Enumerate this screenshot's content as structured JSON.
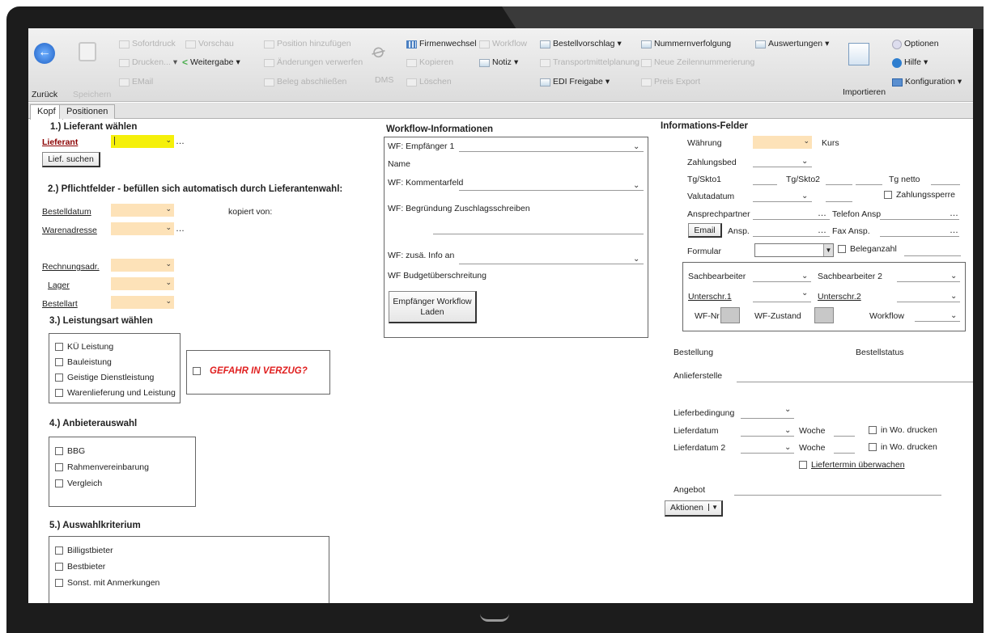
{
  "ribbon": {
    "back": "Zurück",
    "save": "Speichern",
    "sofortdruck": "Sofortdruck",
    "vorschau": "Vorschau",
    "drucken": "Drucken...",
    "weitergabe": "Weitergabe",
    "email": "EMail",
    "position_hinzufuegen": "Position hinzufügen",
    "aenderungen_verwerfen": "Änderungen verwerfen",
    "beleg_abschliessen": "Beleg abschließen",
    "dms": "DMS",
    "firmenwechsel": "Firmenwechsel",
    "workflow": "Workflow",
    "kopieren": "Kopieren",
    "notiz": "Notiz",
    "loeschen": "Löschen",
    "bestellvorschlag": "Bestellvorschlag",
    "transportmittelplanung": "Transportmittelplanung",
    "edi_freigabe": "EDI Freigabe",
    "nummernverfolgung": "Nummernverfolgung",
    "neue_zeilennummerierung": "Neue Zeilennummerierung",
    "preis_export": "Preis Export",
    "auswertungen": "Auswertungen",
    "importieren": "Importieren",
    "optionen": "Optionen",
    "hilfe": "Hilfe",
    "konfiguration": "Konfiguration"
  },
  "tabs": [
    "Kopf",
    "Positionen"
  ],
  "left": {
    "s1_title": "1.) Lieferant wählen",
    "lieferant": "Lieferant",
    "lief_suchen": "Lief. suchen",
    "s2_title": "2.) Pflichtfelder - befüllen sich automatisch durch Lieferantenwahl:",
    "bestelldatum": "Bestelldatum",
    "kopiert_von": "kopiert von:",
    "warenadresse": "Warenadresse",
    "rechnungsadr": "Rechnungsadr.",
    "lager": "Lager",
    "bestellart": "Bestellart",
    "s3_title": "3.) Leistungsart wählen",
    "s3_items": [
      "KÜ Leistung",
      "Bauleistung",
      "Geistige Dienstleistung",
      "Warenlieferung und Leistung"
    ],
    "gefahr": "GEFAHR IN VERZUG?",
    "s4_title": "4.) Anbieterauswahl",
    "s4_items": [
      "BBG",
      "Rahmenvereinbarung",
      "Vergleich"
    ],
    "s5_title": "5.) Auswahlkriterium",
    "s5_items": [
      "Billigstbieter",
      "Bestbieter",
      "Sonst. mit Anmerkungen"
    ]
  },
  "workflow": {
    "title": "Workflow-Informationen",
    "empfaenger": "WF: Empfänger 1",
    "name": "Name",
    "kommentar": "WF: Kommentarfeld",
    "begruendung": "WF: Begründung Zuschlagsschreiben",
    "zusae_info": "WF: zusä. Info an",
    "budget": "WF Budgetüberschreitung",
    "laden_btn": "Empfänger Workflow Laden"
  },
  "info": {
    "title": "Informations-Felder",
    "waehrung": "Währung",
    "kurs": "Kurs",
    "zahlungsbed": "Zahlungsbed",
    "tg_skto1": "Tg/Skto1",
    "tg_skto2": "Tg/Skto2",
    "tg_netto": "Tg netto",
    "valutadatum": "Valutadatum",
    "zahlungssperre": "Zahlungssperre",
    "ansprechpartner": "Ansprechpartner",
    "telefon": "Telefon Ansp",
    "email_btn": "Email",
    "ansp": "Ansp.",
    "fax": "Fax Ansp.",
    "formular": "Formular",
    "beleganzahl": "Beleganzahl",
    "sachbearbeiter": "Sachbearbeiter",
    "sachbearbeiter2": "Sachbearbeiter 2",
    "unterschr1": "Unterschr.1",
    "unterschr2": "Unterschr.2",
    "wf_nr": "WF-Nr",
    "wf_zustand": "WF-Zustand",
    "workflow": "Workflow",
    "bestellung": "Bestellung",
    "bestellstatus": "Bestellstatus",
    "anlieferstelle": "Anlieferstelle",
    "lieferbedingung": "Lieferbedingung",
    "lieferdatum": "Lieferdatum",
    "woche": "Woche",
    "in_wo_drucken": "in Wo. drucken",
    "lieferdatum2": "Lieferdatum 2",
    "liefertermin": "Liefertermin überwachen",
    "angebot": "Angebot",
    "aktionen": "Aktionen"
  }
}
